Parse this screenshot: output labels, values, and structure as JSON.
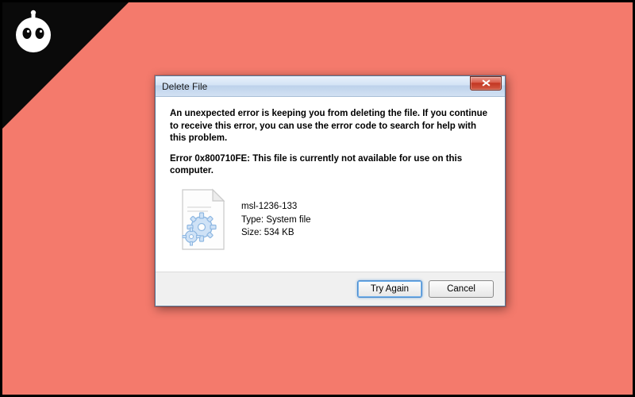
{
  "dialog": {
    "title": "Delete File",
    "message_primary": "An unexpected error is keeping you from deleting the file. If you continue to receive this error, you can use the error code to search for help with this problem.",
    "message_error": "Error 0x800710FE: This file is currently not available for use on this computer.",
    "file": {
      "name": "msl-1236-133",
      "type_label": "Type: System file",
      "size_label": "Size: 534 KB"
    },
    "buttons": {
      "try_again": "Try Again",
      "cancel": "Cancel"
    }
  },
  "icons": {
    "close": "close-icon",
    "file": "system-file-icon",
    "logo": "robot-logo"
  },
  "colors": {
    "background": "#f47a6c",
    "triangle": "#0a0a0a",
    "titlebar_grad_top": "#e8f1fb",
    "titlebar_grad_bot": "#bcd1ea",
    "close_red": "#c23420",
    "accent_blue": "#4a8ccf"
  }
}
